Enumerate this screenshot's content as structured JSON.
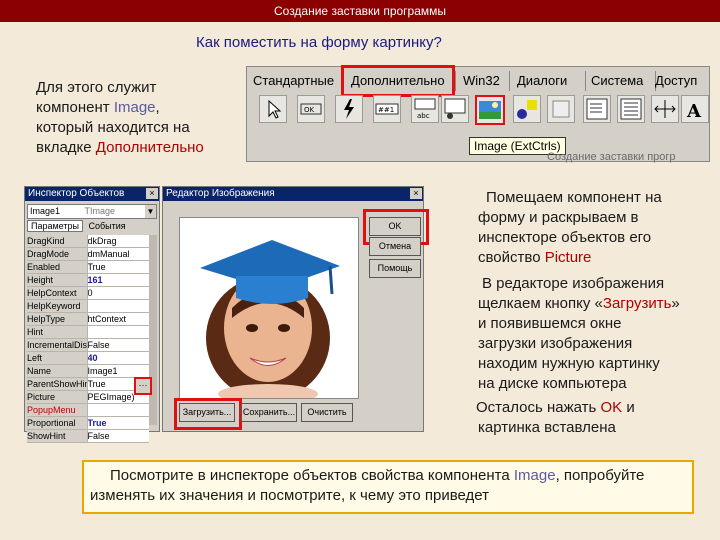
{
  "header": {
    "title": "Создание заставки программы"
  },
  "slide": {
    "question": "Как поместить на форму картинку?"
  },
  "intro": {
    "line1": "Для этого служит",
    "line2a": "компонент ",
    "line2b": "Image",
    "line2c": ",",
    "line3": "который находится на",
    "line4a": "вкладке ",
    "line4b": "Дополнительно"
  },
  "palette": {
    "tabs": [
      "Стандартные",
      "Дополнительно",
      "Win32",
      "Диалоги",
      "Система",
      "Доступ к"
    ],
    "tooltip": "Image (ExtCtrls)",
    "footer": "Создание заставки прогр"
  },
  "inspector": {
    "title": "Инспектор Объектов",
    "combo_name": "Image1",
    "combo_type": "TImage",
    "tab_params": "Параметры",
    "tab_events": "События",
    "rows": [
      {
        "k": "DragKind",
        "v": "dkDrag"
      },
      {
        "k": "DragMode",
        "v": "dmManual"
      },
      {
        "k": "Enabled",
        "v": "True"
      },
      {
        "k": "Height",
        "v": "161"
      },
      {
        "k": "HelpContext",
        "v": "0"
      },
      {
        "k": "HelpKeyword",
        "v": ""
      },
      {
        "k": "HelpType",
        "v": "htContext"
      },
      {
        "k": "Hint",
        "v": ""
      },
      {
        "k": "IncrementalDisp",
        "v": "False"
      },
      {
        "k": "Left",
        "v": "40"
      },
      {
        "k": "Name",
        "v": "Image1"
      },
      {
        "k": "ParentShowHint",
        "v": "True"
      },
      {
        "k": "Picture",
        "v": "PEGImage)"
      },
      {
        "k": "PopupMenu",
        "v": ""
      },
      {
        "k": "Proportional",
        "v": "True"
      },
      {
        "k": "ShowHint",
        "v": "False"
      }
    ],
    "dots": "···"
  },
  "editor": {
    "title": "Редактор Изображения",
    "ok": "OK",
    "cancel": "Отмена",
    "help": "Помощь",
    "load": "Загрузить...",
    "save": "Сохранить...",
    "clear": "Очистить"
  },
  "right": {
    "p1_1": "Помещаем компонент на",
    "p1_2": "форму и раскрываем в",
    "p1_3": "инспекторе объектов его",
    "p1_4a": "свойство ",
    "p1_4b": "Picture",
    "p2_1": "В редакторе изображения",
    "p2_2a": "щелкаем кнопку «",
    "p2_2b": "Загрузить",
    "p2_2c": "»",
    "p2_3": "и появившемся окне",
    "p2_4": "загрузки изображения",
    "p2_5": "находим нужную картинку",
    "p2_6": "на диске компьютера",
    "p3_1a": "Осталось нажать ",
    "p3_1b": "OK",
    "p3_1c": " и",
    "p3_2": "картинка вставлена"
  },
  "bottom": {
    "l1a": "Посмотрите в инспекторе объектов свойства компонента ",
    "l1b": "Image",
    "l1c": ", попробуйте",
    "l2": "изменять их значения и посмотрите, к чему это приведет"
  }
}
